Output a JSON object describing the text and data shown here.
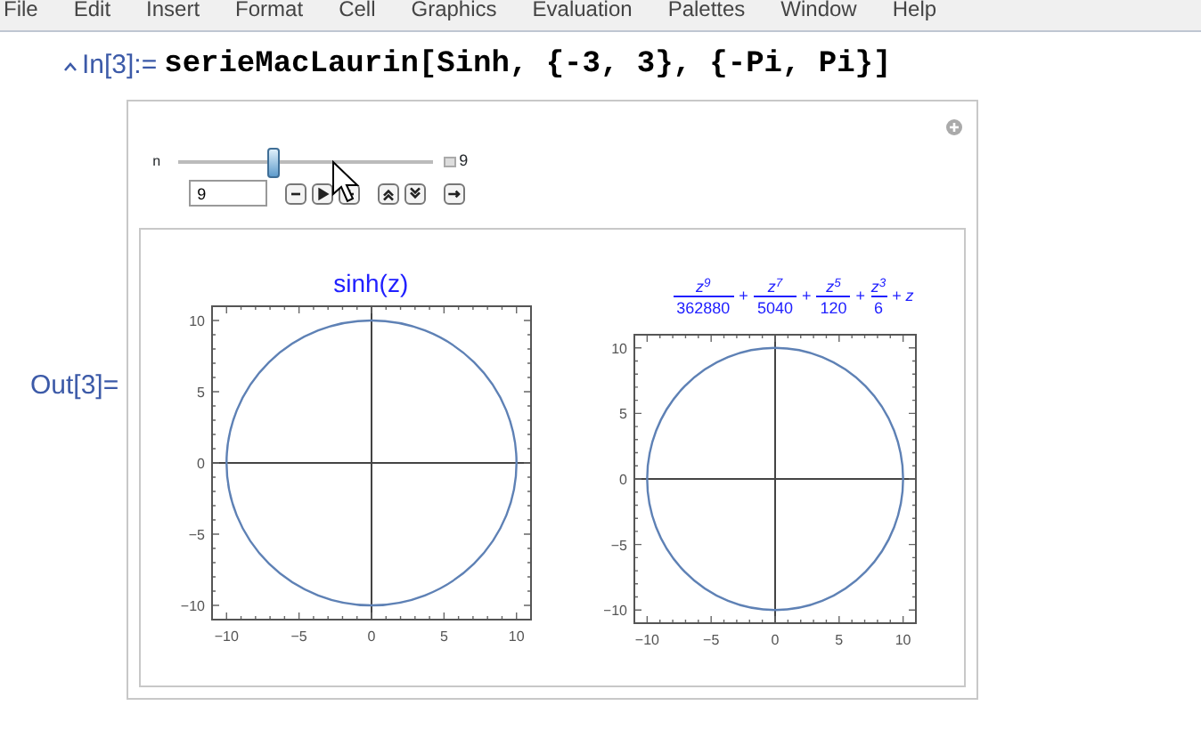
{
  "menu": [
    "File",
    "Edit",
    "Insert",
    "Format",
    "Cell",
    "Graphics",
    "Evaluation",
    "Palettes",
    "Window",
    "Help"
  ],
  "input_cell": {
    "label": "In[3]:=",
    "code": "serieMacLaurin[Sinh, {-3, 3}, {-Pi, Pi}]"
  },
  "output_cell": {
    "label": "Out[3]=",
    "manipulator": {
      "variable": "n",
      "level": 0.38,
      "value_label": "9",
      "field_value": "9"
    },
    "plots": [
      {
        "kind": "title",
        "title": "sinh(z)",
        "x_tick_labels": [
          "−10",
          "−5",
          "0",
          "5",
          "10"
        ],
        "y_tick_labels": [
          "10",
          "5",
          "0",
          "−5",
          "−10"
        ]
      },
      {
        "kind": "formula",
        "formula": {
          "terms": [
            {
              "numerator": "z$^{9}$",
              "denominator": "362880"
            },
            {
              "numerator": "z$^{7}$",
              "denominator": "5040"
            },
            {
              "numerator": "z$^{5}$",
              "denominator": "120"
            },
            {
              "numerator": "z$^{3}$",
              "denominator": "6"
            }
          ],
          "operator": "+",
          "tail": "+ z"
        },
        "x_tick_labels": [
          "−10",
          "−5",
          "0",
          "5",
          "10"
        ],
        "y_tick_labels": [
          "10",
          "5",
          "0",
          "−5",
          "−10"
        ]
      }
    ]
  }
}
